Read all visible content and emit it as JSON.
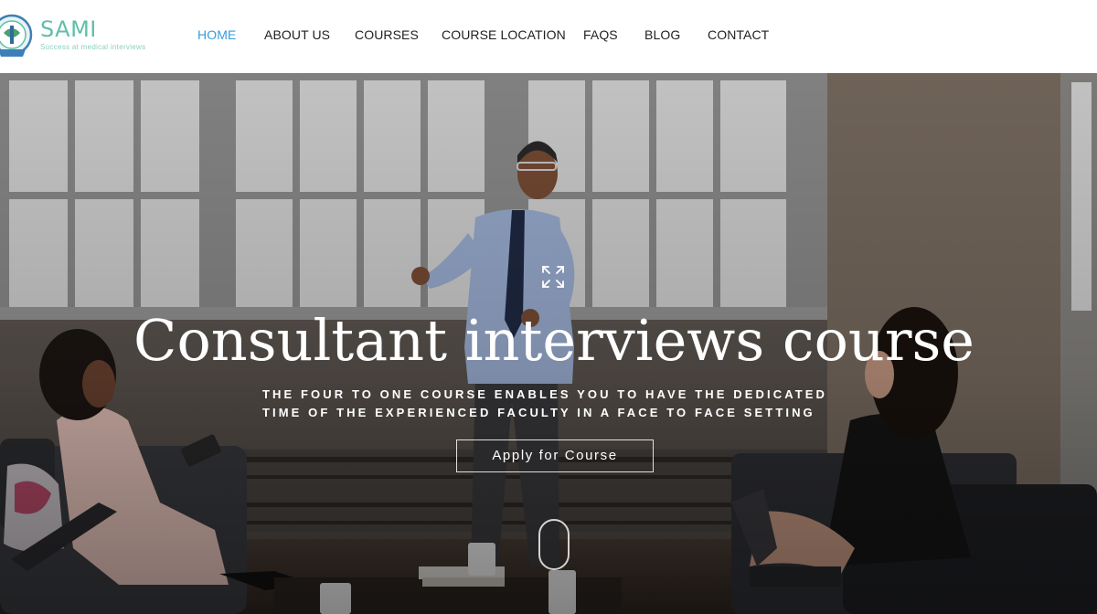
{
  "brand": {
    "name": "SAMI",
    "tagline": "Success at medical interviews",
    "colors": {
      "accent": "#3a9bd9",
      "logo": "#5fbfa8"
    }
  },
  "nav": {
    "items": [
      {
        "label": "HOME",
        "active": true
      },
      {
        "label": "ABOUT US",
        "active": false
      },
      {
        "label": "COURSES",
        "active": false
      },
      {
        "label": "COURSE LOCATION",
        "active": false
      },
      {
        "label": "FAQS",
        "active": false
      },
      {
        "label": "BLOG",
        "active": false
      },
      {
        "label": "CONTACT",
        "active": false
      }
    ]
  },
  "hero": {
    "title": "Consultant interviews course",
    "subtitle_line1": "THE FOUR TO ONE COURSE ENABLES YOU TO HAVE THE DEDICATED",
    "subtitle_line2": "TIME OF THE EXPERIENCED FACULTY IN A FACE TO FACE SETTING",
    "cta_label": "Apply for Course",
    "icons": {
      "expand": "expand-icon",
      "scroll": "scroll-down-icon"
    }
  }
}
